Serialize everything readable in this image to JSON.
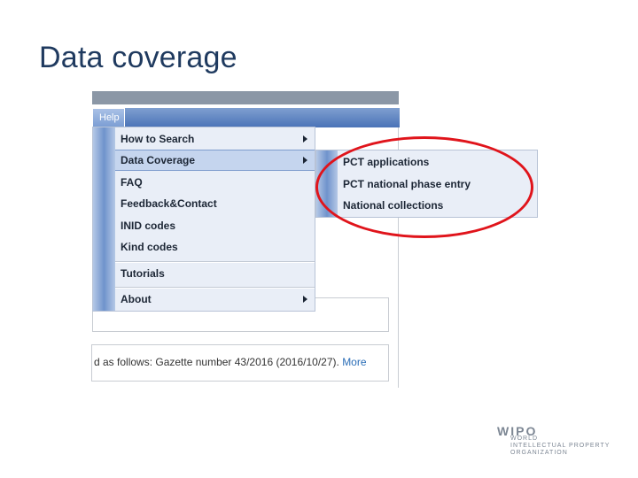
{
  "slide": {
    "title": "Data coverage"
  },
  "app": {
    "menubar": {
      "help_label": "Help"
    },
    "help_menu": {
      "items": [
        {
          "label": "How to Search",
          "has_submenu": true
        },
        {
          "label": "Data Coverage",
          "has_submenu": true,
          "active": true
        },
        {
          "label": "FAQ"
        },
        {
          "label": "Feedback&Contact"
        },
        {
          "label": "INID codes"
        },
        {
          "label": "Kind codes"
        },
        {
          "label": "Tutorials"
        },
        {
          "label": "About",
          "has_submenu": true
        }
      ]
    },
    "data_coverage_submenu": {
      "items": [
        {
          "label": "PCT applications"
        },
        {
          "label": "PCT national phase entry"
        },
        {
          "label": "National collections"
        }
      ]
    },
    "footer": {
      "text": "d as follows: Gazette number 43/2016 (2016/10/27).",
      "more_link": "More"
    }
  },
  "logo": {
    "main": "WIPO",
    "line1": "WORLD",
    "line2": "INTELLECTUAL PROPERTY",
    "line3": "ORGANIZATION"
  },
  "colors": {
    "highlight": "#e0141b",
    "title": "#1f3a5f",
    "menubar": "#4a73b7",
    "link": "#2a6db7"
  }
}
